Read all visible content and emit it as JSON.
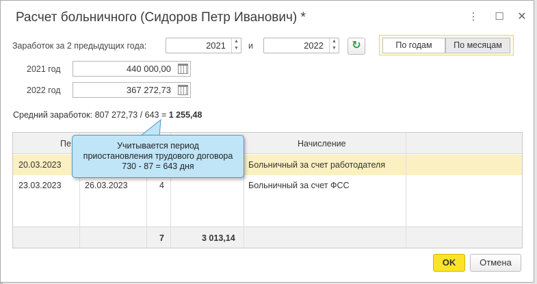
{
  "window": {
    "title": "Расчет больничного (Сидоров Петр Иванович) *",
    "icons": [
      "more-vertical-icon",
      "maximize-icon",
      "close-icon"
    ]
  },
  "earnings": {
    "label": "Заработок за 2 предыдущих года:",
    "year1": "2021",
    "and_label": "и",
    "year2": "2022"
  },
  "toggle": {
    "by_years": "По годам",
    "by_months": "По месяцам"
  },
  "years": [
    {
      "label": "2021 год",
      "amount": "440 000,00"
    },
    {
      "label": "2022 год",
      "amount": "367 272,73"
    }
  ],
  "average": {
    "prefix": "Средний заработок: 807 272,73 / 643 = ",
    "result": "1 255,48"
  },
  "table": {
    "headers": {
      "period": "Пе",
      "accrual": "Начисление"
    },
    "rows": [
      {
        "from": "20.03.2023",
        "to": "",
        "days": "",
        "amount": "",
        "accrual": "Больничный за счет работодателя",
        "selected": true
      },
      {
        "from": "23.03.2023",
        "to": "26.03.2023",
        "days": "4",
        "amount": "",
        "accrual": "Больничный за счет ФСС",
        "selected": false
      }
    ],
    "footer": {
      "days": "7",
      "amount": "3 013,14"
    }
  },
  "tooltip": {
    "line1": "Учитывается период",
    "line2": "приостановления трудового договора",
    "line3": "730 - 87 = 643 дня"
  },
  "buttons": {
    "ok": "OK",
    "cancel": "Отмена"
  },
  "colors": {
    "accent_yellow": "#fbe32a",
    "selected_row": "#fbf0c2",
    "tooltip_bg": "#bfe5f7",
    "refresh_green": "#2e9e3e"
  }
}
